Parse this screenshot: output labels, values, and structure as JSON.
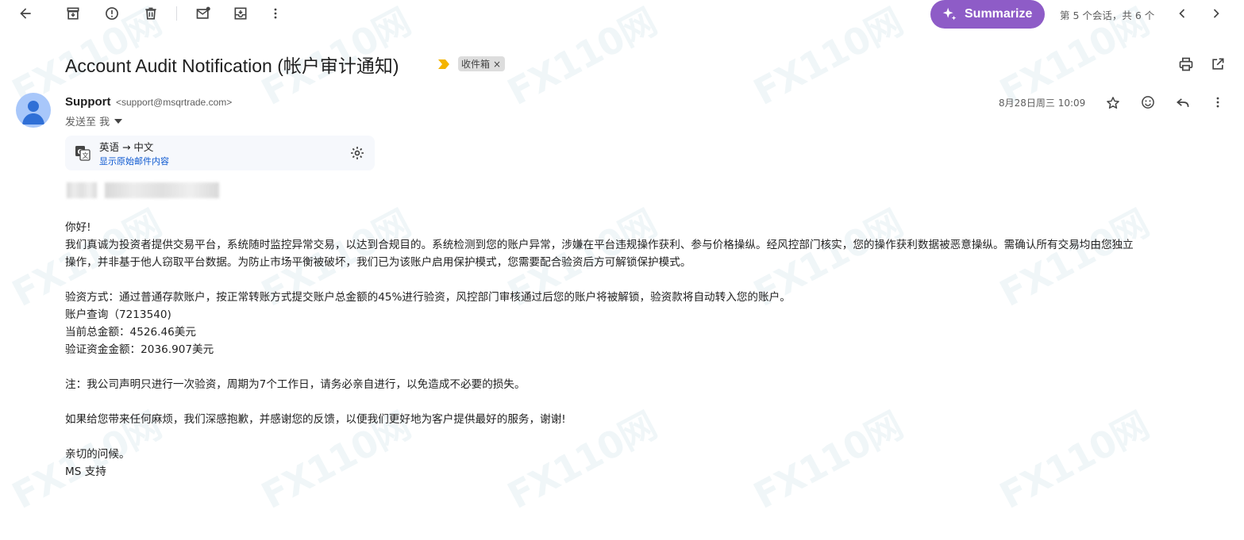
{
  "toolbar": {
    "back_icon": "arrow-back-icon",
    "archive_icon": "archive-icon",
    "report_icon": "report-spam-icon",
    "delete_icon": "delete-icon",
    "mark_unread_icon": "mark-unread-icon",
    "move_icon": "move-to-icon",
    "more_icon": "more-vert-icon",
    "summarize_label": "Summarize",
    "pagination_text": "第 5 个会话，共 6 个"
  },
  "subject": {
    "title": "Account Audit Notification (帐户审计通知)",
    "label_chip": "收件箱",
    "label_close": "×"
  },
  "message": {
    "sender_name": "Support",
    "sender_email": "<support@msqrtrade.com>",
    "to_line": "发送至 我",
    "date": "8月28日周三 10:09"
  },
  "translation": {
    "direction": "英语 → 中文",
    "show_original": "显示原始邮件内容"
  },
  "body": {
    "greeting": "你好!",
    "paragraph1": "我们真诚为投资者提供交易平台，系统随时监控异常交易，以达到合规目的。系统检测到您的账户异常，涉嫌在平台违规操作获利、参与价格操纵。经风控部门核实，您的操作获利数据被恶意操纵。需确认所有交易均由您独立",
    "paragraph1_cont": "操作，并非基于他人窃取平台数据。为防止市场平衡被破坏，我们已为该账户启用保护模式，您需要配合验资后方可解锁保护模式。",
    "verify_method": "验资方式：通过普通存款账户，按正常转账方式提交账户总金额的45%进行验资，风控部门审核通过后您的账户将被解锁，验资款将自动转入您的账户。",
    "account_query": "账户查询（7213540)",
    "current_total": "当前总金额：4526.46美元",
    "verify_amount": "验证资金金额：2036.907美元",
    "note": "注：我公司声明只进行一次验资，周期为7个工作日，请务必亲自进行，以免造成不必要的损失。",
    "apology": "如果给您带来任何麻烦，我们深感抱歉，并感谢您的反馈，以便我们更好地为客户提供最好的服务，谢谢!",
    "closing": "亲切的问候。",
    "signature": "MS 支持"
  },
  "watermark_text": "FX110网",
  "colors": {
    "summarize_bg": "#8e5cc7",
    "important_marker": "#f4b400",
    "link_blue": "#0b57d0",
    "avatar_bg": "#a8c7fa",
    "avatar_fg": "#2f6fd6"
  }
}
